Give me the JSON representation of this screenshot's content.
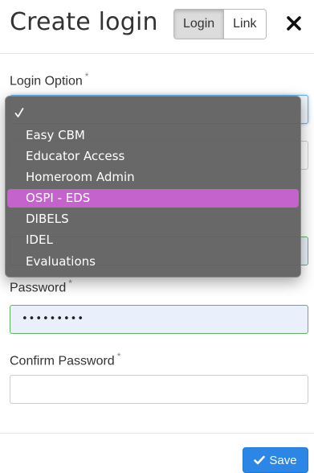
{
  "header": {
    "title": "Create login",
    "toggle": {
      "login_label": "Login",
      "link_label": "Link",
      "active": "Login"
    },
    "close_icon": "close-icon"
  },
  "form": {
    "login_option": {
      "label": "Login Option",
      "required_mark": "*"
    },
    "username": {
      "required_mark": "*"
    },
    "password": {
      "label": "Password",
      "required_mark": "*",
      "value_mask": "•••••••••"
    },
    "confirm_password": {
      "label": "Confirm Password",
      "required_mark": "*",
      "value": ""
    }
  },
  "dropdown": {
    "checked_index": 0,
    "selected_index": 4,
    "options": [
      {
        "label": ""
      },
      {
        "label": "Easy CBM"
      },
      {
        "label": "Educator Access"
      },
      {
        "label": "Homeroom Admin"
      },
      {
        "label": "OSPI - EDS"
      },
      {
        "label": "DIBELS"
      },
      {
        "label": "IDEL"
      },
      {
        "label": "Evaluations"
      }
    ],
    "highlight_color": "#c463cc"
  },
  "footer": {
    "save_label": "Save",
    "save_icon": "check-icon",
    "accent": "#2b86e6"
  }
}
